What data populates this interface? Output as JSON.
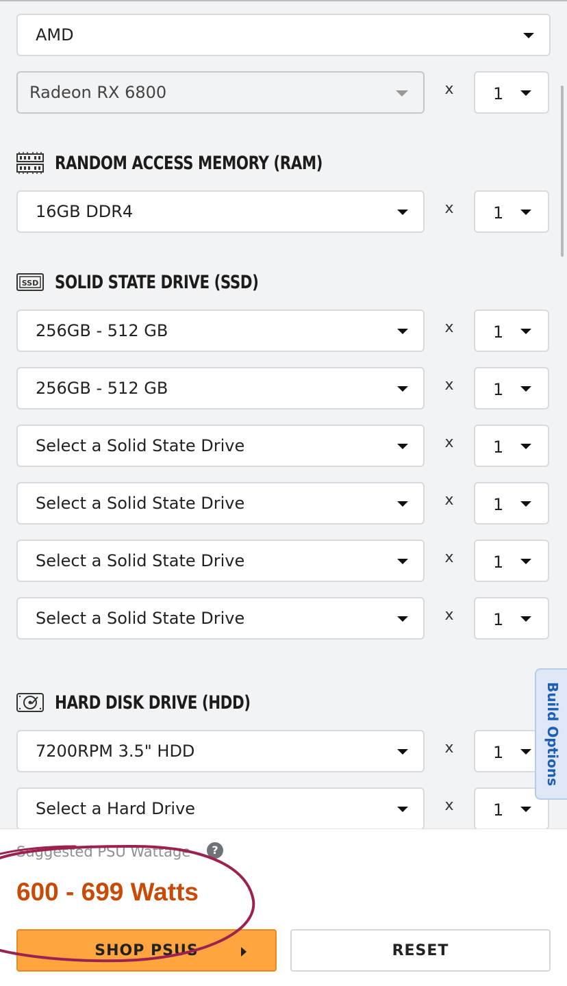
{
  "gpu": {
    "brand": "AMD",
    "model_placeholder": "Radeon RX 6800",
    "qty": "1"
  },
  "multiplier": "x",
  "ram": {
    "title": "RANDOM ACCESS MEMORY (RAM)",
    "rows": [
      {
        "value": "16GB DDR4",
        "qty": "1"
      }
    ]
  },
  "ssd": {
    "title": "SOLID STATE DRIVE (SSD)",
    "rows": [
      {
        "value": "256GB - 512 GB",
        "qty": "1"
      },
      {
        "value": "256GB - 512 GB",
        "qty": "1"
      },
      {
        "value": "Select a Solid State Drive",
        "qty": "1"
      },
      {
        "value": "Select a Solid State Drive",
        "qty": "1"
      },
      {
        "value": "Select a Solid State Drive",
        "qty": "1"
      },
      {
        "value": "Select a Solid State Drive",
        "qty": "1"
      }
    ]
  },
  "hdd": {
    "title": "HARD DISK DRIVE (HDD)",
    "rows": [
      {
        "value": "7200RPM 3.5\" HDD",
        "qty": "1"
      },
      {
        "value": "Select a Hard Drive",
        "qty": "1"
      }
    ]
  },
  "build_options_tab": "Build Options",
  "psu": {
    "label": "Suggested PSU Wattage",
    "help": "?",
    "value": "600 - 699 Watts"
  },
  "buttons": {
    "shop": "SHOP PSUS",
    "reset": "RESET"
  },
  "colors": {
    "accent_orange": "#ffa53f",
    "wattage_text": "#c94a05",
    "build_tab_blue": "#1d5fb6",
    "annotation": "#9b2150"
  }
}
